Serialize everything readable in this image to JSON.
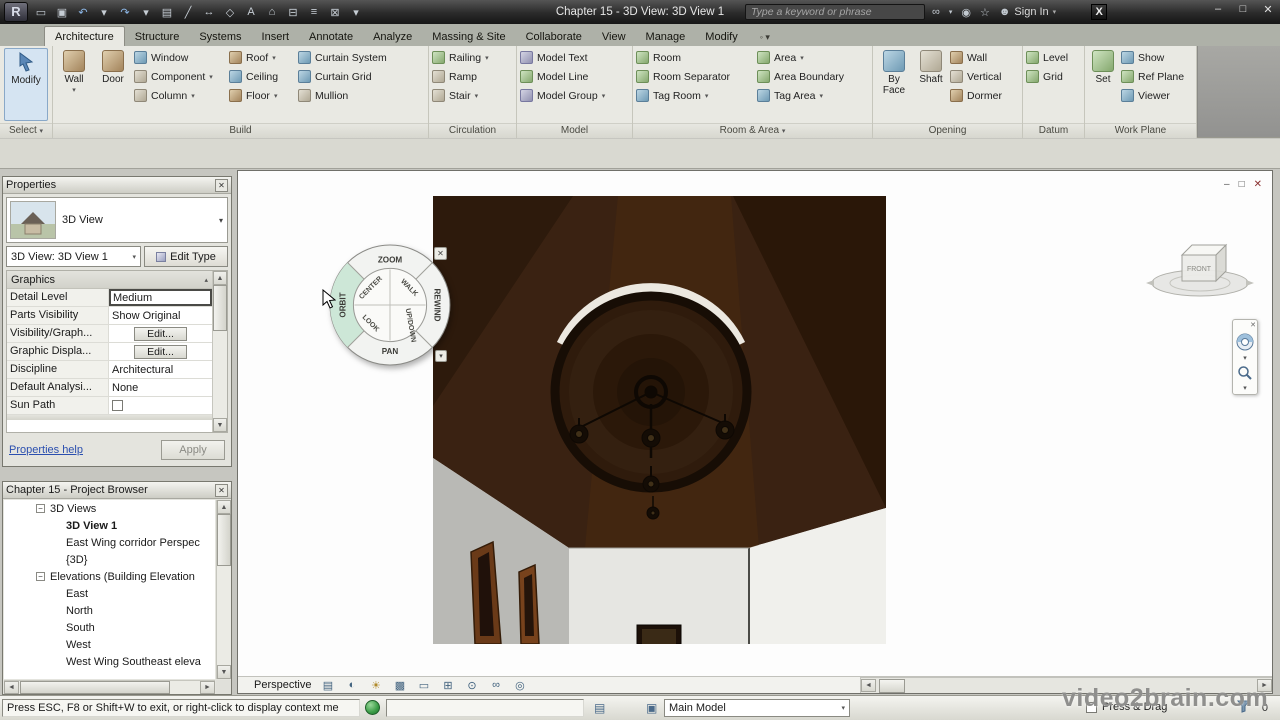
{
  "title_bar": {
    "app_button": "R",
    "title": "Chapter 15 - 3D View: 3D View 1",
    "search_placeholder": "Type a keyword or phrase",
    "sign_in_label": "Sign In"
  },
  "icons": {
    "caret_down": "▾",
    "arrow_up": "▲",
    "arrow_down": "▼",
    "arrow_left": "◄",
    "arrow_right": "►",
    "minus": "−",
    "close": "✕",
    "minimize": "–",
    "maximize": "□",
    "open": "▭",
    "save": "▣",
    "undo": "↶",
    "redo": "↷",
    "print": "▤",
    "measure": "╱",
    "aligned_dimension": "↔",
    "tag": "◇",
    "text": "A",
    "default_3d_view": "⌂",
    "section": "⊟",
    "thin_lines": "≡",
    "close_hidden_windows": "⊠",
    "search_binoculars": "∞",
    "communication_center": "◉",
    "favorites": "☆",
    "user": "☻",
    "exchange_apps": "X",
    "ribbon_cycle": "◦",
    "collapse_section": "▴",
    "worksets": "▤",
    "design_options": "▣",
    "detail_level": "▤",
    "visual_style": "◐",
    "sun_path": "☀",
    "shadows": "▩",
    "crop_view": "▭",
    "show_crop": "⊞",
    "lock_view": "⊙",
    "hide_isolate": "∞",
    "reveal_hidden": "◎"
  },
  "ribbon_tabs": [
    {
      "label": "Architecture"
    },
    {
      "label": "Structure"
    },
    {
      "label": "Systems"
    },
    {
      "label": "Insert"
    },
    {
      "label": "Annotate"
    },
    {
      "label": "Analyze"
    },
    {
      "label": "Massing & Site"
    },
    {
      "label": "Collaborate"
    },
    {
      "label": "View"
    },
    {
      "label": "Manage"
    },
    {
      "label": "Modify"
    }
  ],
  "ribbon": {
    "select": {
      "label": "Select",
      "modify": "Modify"
    },
    "build": {
      "label": "Build",
      "wall": "Wall",
      "door": "Door",
      "window": "Window",
      "component": "Component",
      "column": "Column",
      "roof": "Roof",
      "ceiling": "Ceiling",
      "floor": "Floor",
      "curtain_system": "Curtain System",
      "curtain_grid": "Curtain Grid",
      "mullion": "Mullion"
    },
    "circulation": {
      "label": "Circulation",
      "railing": "Railing",
      "ramp": "Ramp",
      "stair": "Stair"
    },
    "model": {
      "label": "Model",
      "model_text": "Model Text",
      "model_line": "Model Line",
      "model_group": "Model Group"
    },
    "room_area": {
      "label": "Room & Area",
      "room": "Room",
      "room_separator": "Room Separator",
      "tag_room": "Tag Room",
      "area": "Area",
      "area_boundary": "Area Boundary",
      "tag_area": "Tag Area"
    },
    "opening": {
      "label": "Opening",
      "by_face": "By Face",
      "shaft": "Shaft",
      "wall": "Wall",
      "vertical": "Vertical",
      "dormer": "Dormer"
    },
    "datum": {
      "label": "Datum",
      "level": "Level",
      "grid": "Grid"
    },
    "work_plane": {
      "label": "Work Plane",
      "set": "Set",
      "show": "Show",
      "ref_plane": "Ref Plane",
      "viewer": "Viewer"
    }
  },
  "properties": {
    "header": "Properties",
    "type_name": "3D View",
    "view_selector": "3D View: 3D View 1",
    "edit_type": "Edit Type",
    "graphics_section": "Graphics",
    "rows": [
      {
        "name": "Detail Level",
        "value": "Medium"
      },
      {
        "name": "Parts Visibility",
        "value": "Show Original"
      },
      {
        "name": "Visibility/Graph...",
        "value": "Edit..."
      },
      {
        "name": "Graphic Displa...",
        "value": "Edit..."
      },
      {
        "name": "Discipline",
        "value": "Architectural"
      },
      {
        "name": "Default Analysi...",
        "value": "None"
      },
      {
        "name": "Sun Path",
        "value": ""
      }
    ],
    "help_link": "Properties help",
    "apply_button": "Apply"
  },
  "project_browser": {
    "header": "Chapter 15 - Project Browser",
    "nodes": {
      "views_3d": "3D Views",
      "view_3d_1": "3D View 1",
      "east_wing": "East Wing corridor Perspec",
      "default_3d": "{3D}",
      "elevations": "Elevations (Building Elevation",
      "east": "East",
      "north": "North",
      "south": "South",
      "west": "West",
      "west_wing": "West Wing Southeast eleva"
    }
  },
  "steering_wheel": {
    "zoom": "ZOOM",
    "rewind": "REWIND",
    "pan": "PAN",
    "orbit": "ORBIT",
    "center": "CENTER",
    "walk": "WALK",
    "look": "LOOK",
    "up_down": "UP/DOWN"
  },
  "view_cube": {
    "front_label": "FRONT"
  },
  "view_control_bar": {
    "scale_label": "Perspective"
  },
  "status_bar": {
    "message": "Press ESC, F8 or Shift+W to exit, or right-click to display context me",
    "design_option": "Main Model",
    "press_drag_label": "Press & Drag",
    "selection_count": "0"
  },
  "watermark": "video2brain.com"
}
